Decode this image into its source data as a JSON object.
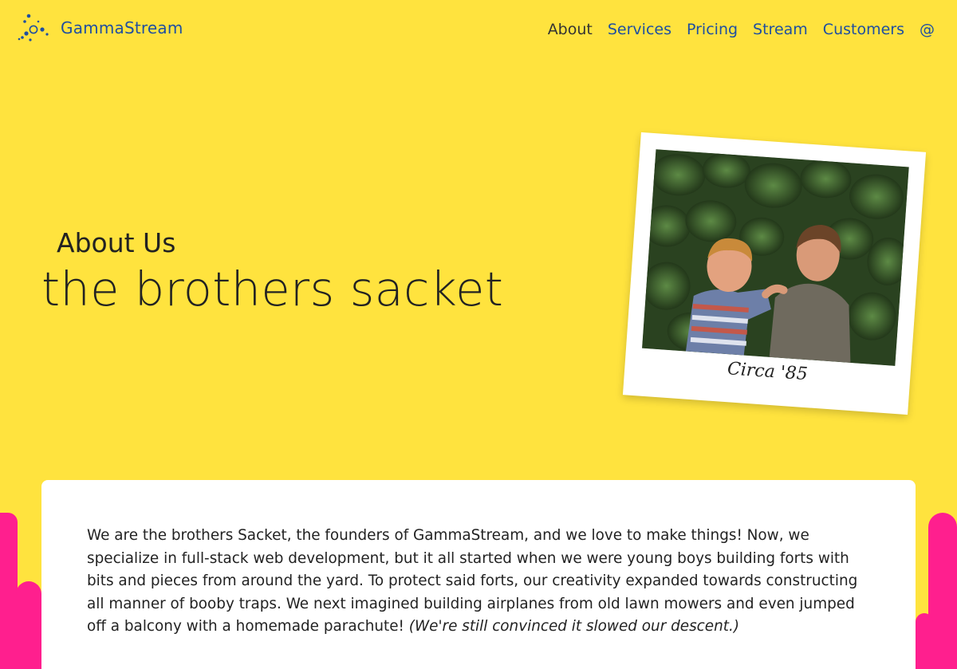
{
  "brand": {
    "name": "GammaStream",
    "logo_icon": "molecule-dots-icon",
    "color": "#1f4fa0"
  },
  "nav": {
    "items": [
      {
        "label": "About",
        "active": true
      },
      {
        "label": "Services"
      },
      {
        "label": "Pricing"
      },
      {
        "label": "Stream"
      },
      {
        "label": "Customers"
      },
      {
        "label": "@"
      }
    ]
  },
  "hero": {
    "eyebrow": "About Us",
    "title": "the brothers sacket"
  },
  "polaroid": {
    "caption": "Circa '85"
  },
  "about": {
    "body": "We are the brothers Sacket, the founders of GammaStream, and we love to make things! Now, we specialize in full-stack web development, but it all started when we were young boys building forts with bits and pieces from around the yard. To protect said forts, our creativity expanded towards constructing all manner of booby traps. We next imagined building airplanes from old lawn mowers and even jumped off a balcony with a homemade parachute!",
    "aside": "(We're still convinced it slowed our descent.)"
  },
  "colors": {
    "background": "#ffe33e",
    "accent_pink": "#ff1f8e",
    "card": "#ffffff"
  }
}
